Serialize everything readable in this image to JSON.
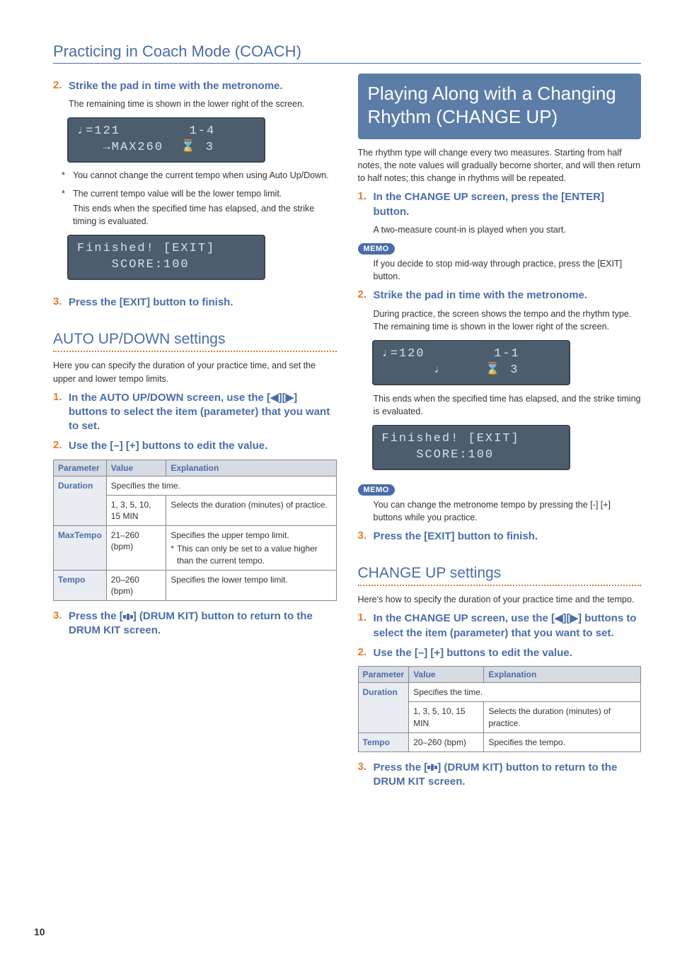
{
  "page_title": "Practicing in Coach Mode (COACH)",
  "page_number": "10",
  "left": {
    "step2_title": "Strike the pad in time with the metronome.",
    "step2_body": "The remaining time is shown in the lower right of the screen.",
    "lcd1_line1": "♩=121        1-4",
    "lcd1_line2": "   →MAX260  ⌛ 3",
    "bullet1": "You cannot change the current tempo when using Auto Up/Down.",
    "bullet2a": "The current tempo value will be the lower tempo limit.",
    "bullet2b": "This ends when the specified time has elapsed, and the strike timing is evaluated.",
    "lcd2_line1": "Finished! [EXIT]",
    "lcd2_line2": "    SCORE:100",
    "step3_title": "Press the [EXIT] button to finish.",
    "section_header": "AUTO UP/DOWN settings",
    "section_intro": "Here you can specify the duration of your practice time, and set the upper and lower tempo limits.",
    "s_step1": "In the AUTO UP/DOWN screen, use the [◀][▶] buttons to select the item (parameter) that you want to set.",
    "s_step2": "Use the [–] [+] buttons to edit the value.",
    "table_headers": {
      "p": "Parameter",
      "v": "Value",
      "e": "Explanation"
    },
    "table": [
      {
        "param": "Duration",
        "span_text": "Specifies the time.",
        "value": "1, 3, 5, 10, 15 MIN",
        "explanation": "Selects the duration (minutes) of practice."
      },
      {
        "param": "MaxTempo",
        "value": "21–260 (bpm)",
        "explanation_line1": "Specifies the upper tempo limit.",
        "explanation_note": "This can only be set to a value higher than the current tempo."
      },
      {
        "param": "Tempo",
        "value": "20–260 (bpm)",
        "explanation": "Specifies the lower tempo limit."
      }
    ],
    "s_step3_a": "Press the [",
    "s_step3_b": "] (DRUM KIT) button to return to the DRUM KIT screen."
  },
  "right": {
    "big_title": "Playing Along with a Changing Rhythm (CHANGE UP)",
    "intro": "The rhythm type will change every two measures. Starting from half notes, the note values will gradually become shorter, and will then return to half notes; this change in rhythms will be repeated.",
    "step1_title": "In the CHANGE UP screen, press the [ENTER] button.",
    "step1_body": "A two-measure count-in is played when you start.",
    "memo_label": "MEMO",
    "memo1_body": "If you decide to stop mid-way through practice, press the [EXIT] button.",
    "step2_title": "Strike the pad in time with the metronome.",
    "step2_body": "During practice, the screen shows the tempo and the rhythm type. The remaining time is shown in the lower right of the screen.",
    "lcd1_line1": "♩=120        1-1",
    "lcd1_line2": "      ♩     ⌛ 3",
    "step2_body2": "This ends when the specified time has elapsed, and the strike timing is evaluated.",
    "lcd2_line1": "Finished! [EXIT]",
    "lcd2_line2": "    SCORE:100",
    "memo2_body": "You can change the metronome tempo by pressing the [-] [+] buttons while you practice.",
    "step3_title": "Press the [EXIT] button to finish.",
    "section_header": "CHANGE UP settings",
    "section_intro": "Here's how to specify the duration of your practice time and the tempo.",
    "s_step1": "In the CHANGE UP screen, use the [◀][▶] buttons to select the item (parameter) that you want to set.",
    "s_step2": "Use the [–] [+] buttons to edit the value.",
    "table_headers": {
      "p": "Parameter",
      "v": "Value",
      "e": "Explanation"
    },
    "table": [
      {
        "param": "Duration",
        "span_text": "Specifies the time.",
        "value": "1, 3, 5, 10, 15 MIN",
        "explanation": "Selects the duration (minutes) of practice."
      },
      {
        "param": "Tempo",
        "value": "20–260 (bpm)",
        "explanation": "Specifies the tempo."
      }
    ],
    "s_step3_a": "Press the [",
    "s_step3_b": "] (DRUM KIT) button to return to the DRUM KIT screen."
  }
}
